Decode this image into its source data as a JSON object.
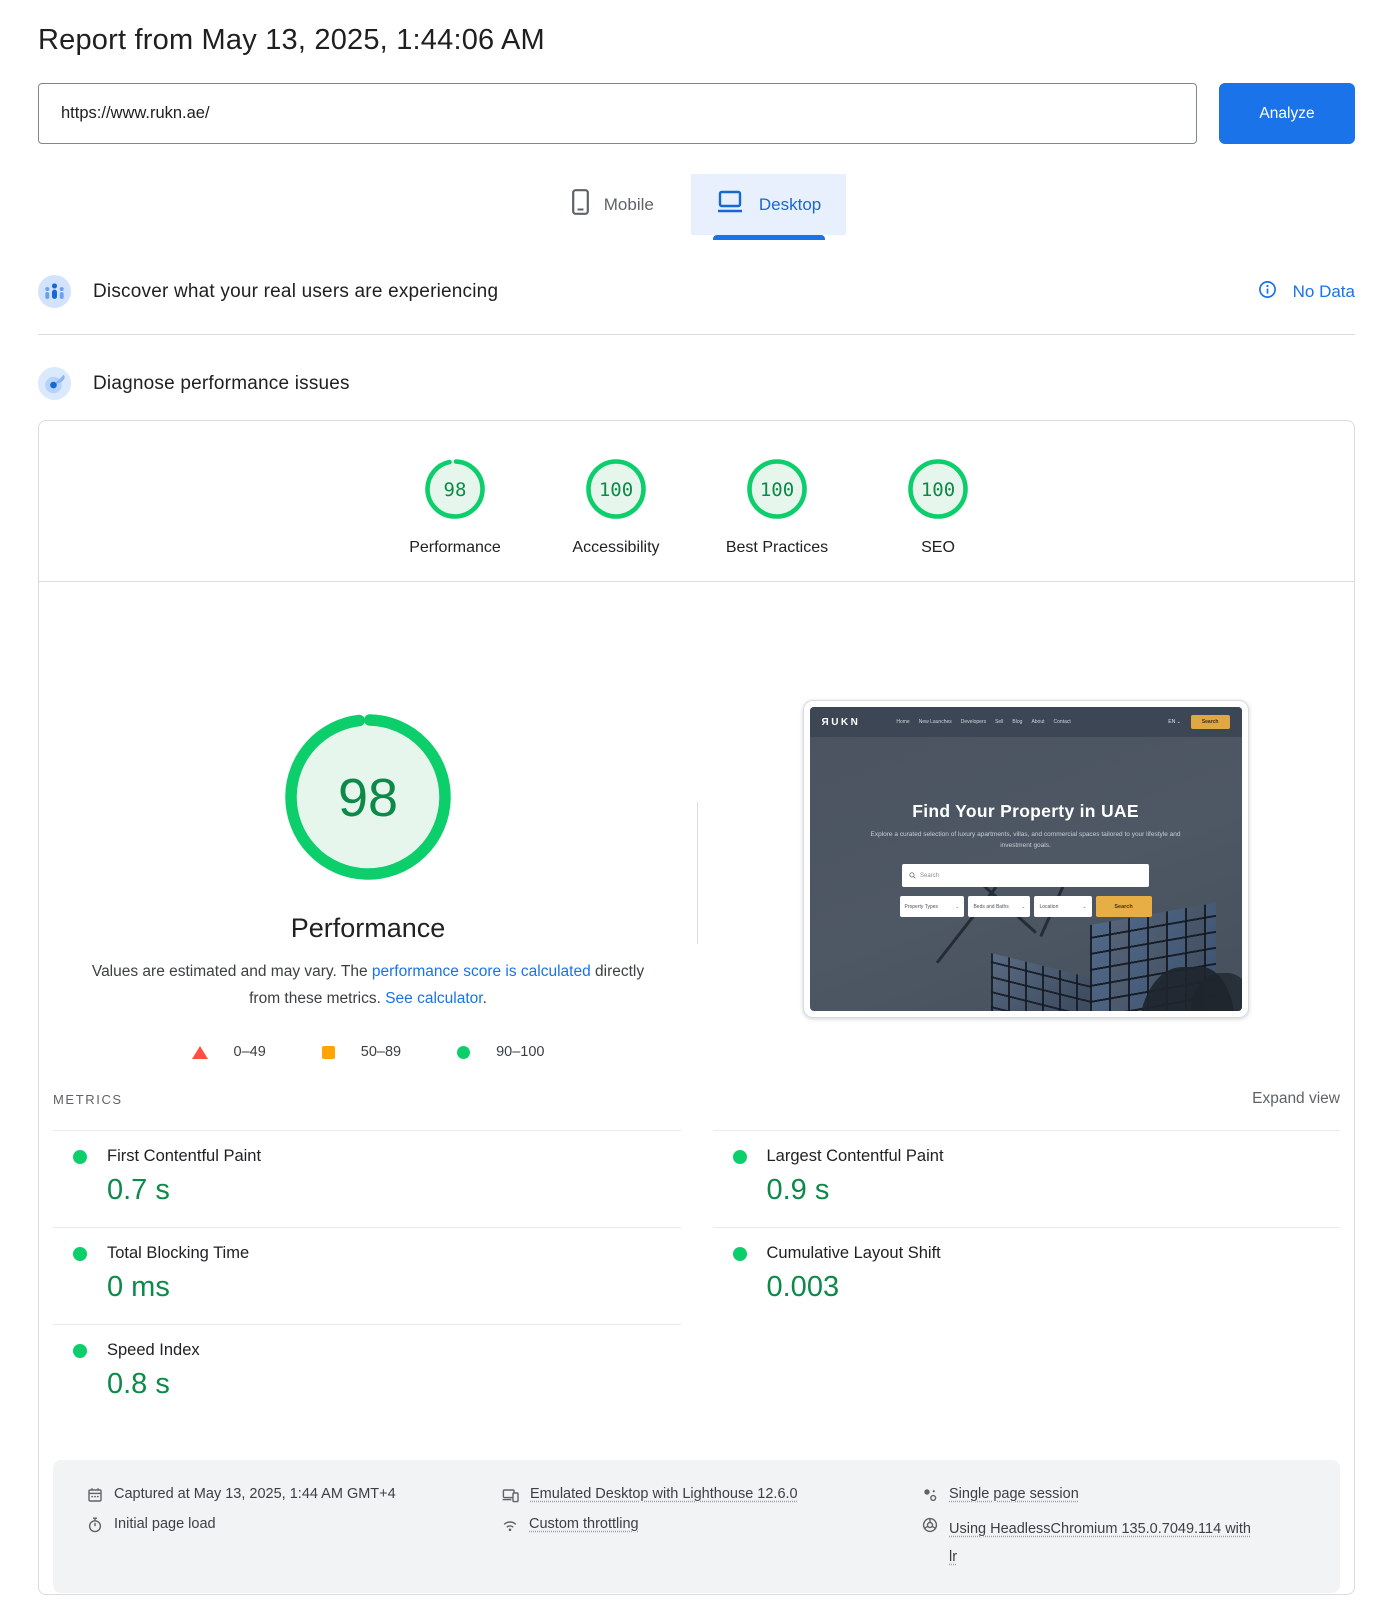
{
  "header": {
    "title": "Report from May 13, 2025, 1:44:06 AM",
    "url_value": "https://www.rukn.ae/",
    "analyze_label": "Analyze"
  },
  "tabs": {
    "mobile": "Mobile",
    "desktop": "Desktop"
  },
  "rum": {
    "heading": "Discover what your real users are experiencing",
    "status": "No Data"
  },
  "lab": {
    "heading": "Diagnose performance issues"
  },
  "categories": [
    {
      "label": "Performance",
      "score": "98"
    },
    {
      "label": "Accessibility",
      "score": "100"
    },
    {
      "label": "Best Practices",
      "score": "100"
    },
    {
      "label": "SEO",
      "score": "100"
    }
  ],
  "gauge": {
    "score": "98",
    "title": "Performance",
    "note_p1": "Values are estimated and may vary. The ",
    "note_link1": "performance score is calculated",
    "note_p2": " directly from these metrics. ",
    "note_link2": "See calculator",
    "note_p3": "."
  },
  "legend": [
    {
      "label": "0–49"
    },
    {
      "label": "50–89"
    },
    {
      "label": "90–100"
    }
  ],
  "metrics": {
    "heading": "METRICS",
    "expand_label": "Expand view",
    "items": [
      {
        "label": "First Contentful Paint",
        "value": "0.7 s"
      },
      {
        "label": "Largest Contentful Paint",
        "value": "0.9 s"
      },
      {
        "label": "Total Blocking Time",
        "value": "0 ms"
      },
      {
        "label": "Cumulative Layout Shift",
        "value": "0.003"
      },
      {
        "label": "Speed Index",
        "value": "0.8 s"
      }
    ]
  },
  "screenshot": {
    "brand": "ЯUKN",
    "nav": [
      "Home",
      "New Launches",
      "Developers",
      "Sell",
      "Blog",
      "About",
      "Contact"
    ],
    "lang": "EN ⌄",
    "nav_search": "Search",
    "headline": "Find Your Property in UAE",
    "subline": "Explore a curated selection of luxury apartments, villas, and commercial spaces tailored to your lifestyle and investment goals.",
    "search_placeholder": "Search",
    "filters": [
      "Property Types",
      "Beds and Baths",
      "Location"
    ],
    "filter_search": "Search"
  },
  "env": {
    "captured": "Captured at May 13, 2025, 1:44 AM GMT+4",
    "initial_load": "Initial page load",
    "emulated": "Emulated Desktop with Lighthouse 12.6.0",
    "throttling": "Custom throttling",
    "session": "Single page session",
    "chromium": "Using HeadlessChromium 135.0.7049.114 with lr"
  },
  "colors": {
    "accent_blue": "#1a73e8",
    "tab_blue": "#1967d2",
    "score_green": "#0cce6b",
    "green_text": "#0d8a4a",
    "orange": "#ffa400",
    "red": "#ff4e42",
    "gold": "#dfa842"
  }
}
